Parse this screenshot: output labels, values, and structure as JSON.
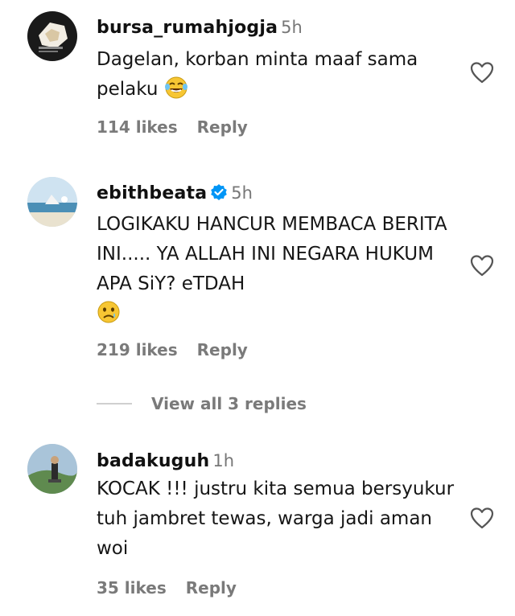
{
  "comments": [
    {
      "username": "bursa_rumahjogja",
      "time": "5h",
      "text": "Dagelan, korban minta maaf sama pelaku",
      "emoji": "face-with-tears-of-joy",
      "likes": "114 likes",
      "reply": "Reply",
      "verified": false
    },
    {
      "username": "ebithbeata",
      "time": "5h",
      "text": "LOGIKAKU HANCUR MEMBACA BERITA INI..... YA ALLAH INI NEGARA HUKUM APA SiY? eTDAH",
      "emoji": "sad-face-with-tear",
      "likes": "219 likes",
      "reply": "Reply",
      "verified": true
    },
    {
      "username": "badakuguh",
      "time": "1h",
      "text": "KOCAK !!! justru kita semua bersyukur tuh jambret tewas, warga jadi aman woi",
      "likes": "35 likes",
      "reply": "Reply",
      "verified": false
    }
  ],
  "view_replies": "View all 3 replies",
  "colors": {
    "verified": "#0095f6",
    "meta": "#7a7a7a",
    "text": "#161616"
  }
}
